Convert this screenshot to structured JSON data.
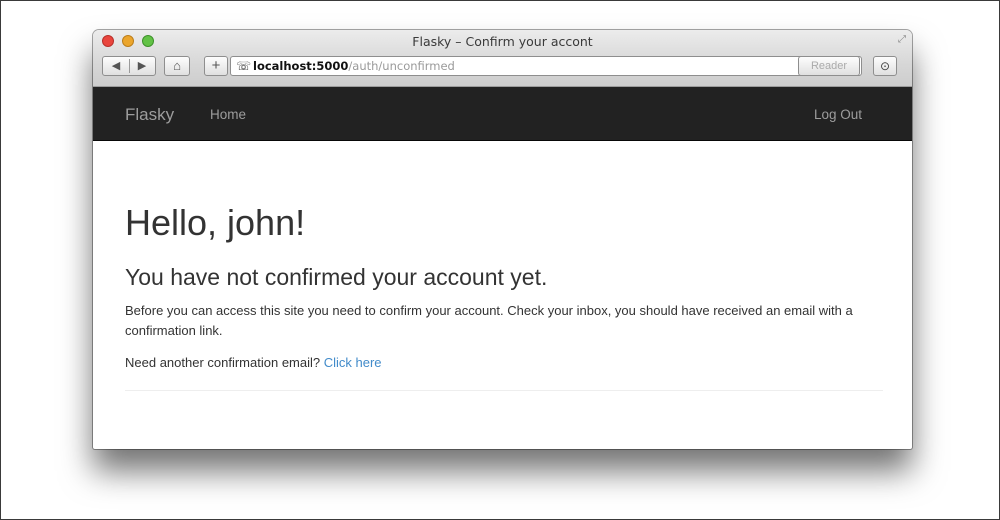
{
  "window": {
    "title": "Flasky – Confirm your accont",
    "url_host": "localhost:5000",
    "url_path": "/auth/unconfirmed",
    "reader_label": "Reader"
  },
  "navbar": {
    "brand": "Flasky",
    "home": "Home",
    "logout": "Log Out",
    "background": "#222222",
    "text_color": "#9d9d9d"
  },
  "page": {
    "heading": "Hello, john!",
    "subheading": "You have not confirmed your account yet.",
    "message": "Before you can access this site you need to confirm your account. Check your inbox, you should have received an email with a confirmation link.",
    "resend_prompt": "Need another confirmation email?",
    "resend_link": "Click here",
    "link_color": "#428bca"
  }
}
